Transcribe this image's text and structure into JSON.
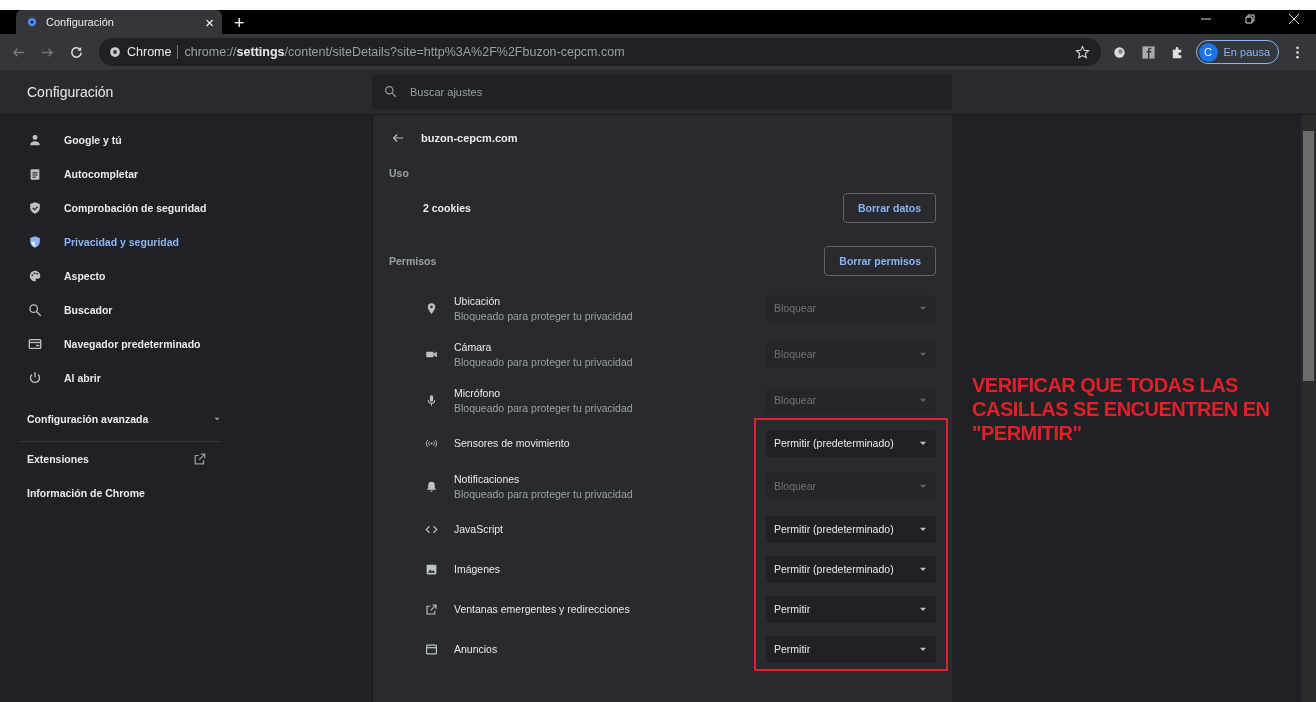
{
  "browser": {
    "tab": {
      "title": "Configuración",
      "close": "×",
      "new_tab": "+"
    },
    "toolbar": {
      "site_label": "Chrome",
      "url": "chrome://**settings**/content/siteDetails?site=http%3A%2F%2Fbuzon-cepcm.com",
      "profile_initial": "C",
      "profile_status": "En pausa"
    }
  },
  "header": {
    "title": "Configuración",
    "search": {
      "placeholder": "Buscar ajustes"
    }
  },
  "sidebar": {
    "items": [
      {
        "label": "Google y tú",
        "selected": false
      },
      {
        "label": "Autocompletar",
        "selected": false
      },
      {
        "label": "Comprobación de seguridad",
        "selected": false
      },
      {
        "label": "Privacidad y seguridad",
        "selected": true
      },
      {
        "label": "Aspecto",
        "selected": false
      },
      {
        "label": "Buscador",
        "selected": false
      },
      {
        "label": "Navegador predeterminado",
        "selected": false
      },
      {
        "label": "Al abrir",
        "selected": false
      }
    ],
    "advanced": {
      "label": "Configuración avanzada",
      "expanded": false
    },
    "links": [
      {
        "label": "Extensiones",
        "external": true
      },
      {
        "label": "Información de Chrome",
        "external": false
      }
    ]
  },
  "site": {
    "title": "buzon-cepcm.com",
    "usage": {
      "heading": "Uso",
      "cookies": "2 cookies",
      "button": "Borrar datos"
    },
    "permissions": {
      "heading": "Permisos",
      "button": "Borrar permisos",
      "items": [
        {
          "name": "Ubicación",
          "note": "Bloqueado para proteger tu privacidad",
          "value": "Bloquear",
          "disabled": true
        },
        {
          "name": "Cámara",
          "note": "Bloqueado para proteger tu privacidad",
          "value": "Bloquear",
          "disabled": true
        },
        {
          "name": "Micrófono",
          "note": "Bloqueado para proteger tu privacidad",
          "value": "Bloquear",
          "disabled": true
        },
        {
          "name": "Sensores de movimiento",
          "value": "Permitir (predeterminado)",
          "disabled": false
        },
        {
          "name": "Notificaciones",
          "note": "Bloqueado para proteger tu privacidad",
          "value": "Bloquear",
          "disabled": true
        },
        {
          "name": "JavaScript",
          "value": "Permitir (predeterminado)",
          "disabled": false
        },
        {
          "name": "Imágenes",
          "value": "Permitir (predeterminado)",
          "disabled": false
        },
        {
          "name": "Ventanas emergentes y redirecciones",
          "value": "Permitir",
          "disabled": false
        },
        {
          "name": "Anuncios",
          "value": "Permitir",
          "disabled": false
        }
      ]
    }
  },
  "annotation": {
    "text": "VERIFICAR QUE TODAS LAS CASILLAS SE ENCUENTREN EN \"PERMITIR\""
  }
}
